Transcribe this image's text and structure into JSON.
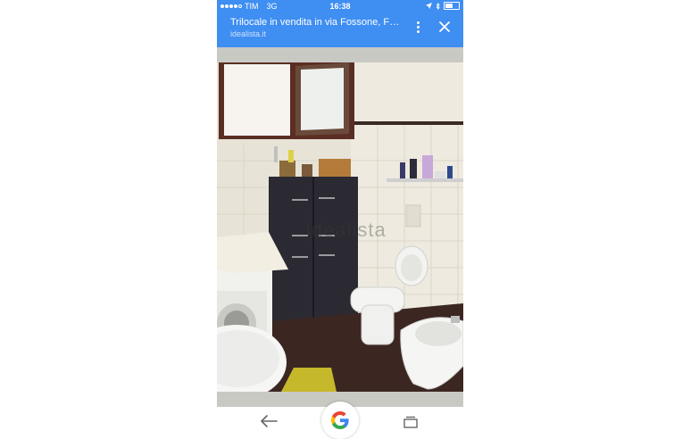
{
  "status_bar": {
    "carrier": "TIM",
    "network": "3G",
    "time": "16:38"
  },
  "header": {
    "title": "Trilocale in vendita in via Fossone, Fontia...",
    "domain": "idealista.it"
  },
  "photo": {
    "watermark": "idealista"
  },
  "colors": {
    "accent": "#3f8ef2",
    "viewer_background": "#c9c9c4"
  },
  "icons": {
    "menu": "more-vert-icon",
    "close": "close-icon",
    "back": "back-arrow-icon",
    "google": "google-g-icon",
    "tabs": "tabs-icon"
  }
}
